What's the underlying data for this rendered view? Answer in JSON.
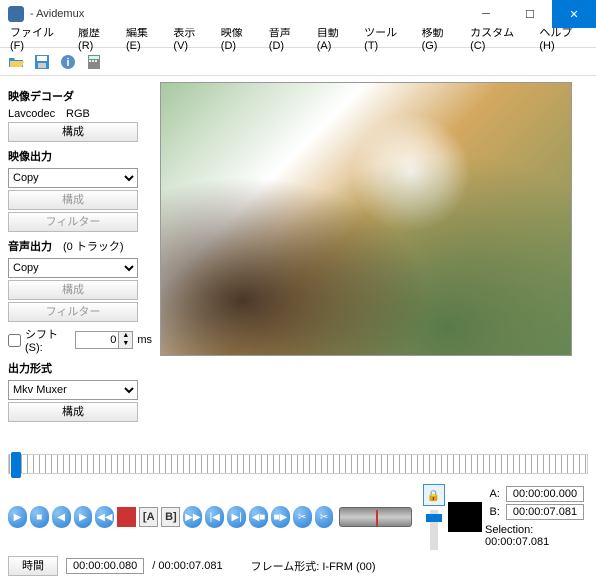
{
  "title": "- Avidemux",
  "menu": [
    "ファイル(F)",
    "履歴(R)",
    "編集(E)",
    "表示(V)",
    "映像(D)",
    "音声(D)",
    "自動(A)",
    "ツール(T)",
    "移動(G)",
    "カスタム(C)",
    "ヘルプ(H)"
  ],
  "sidebar": {
    "decoder_h": "映像デコーダ",
    "lavcodec": "Lavcodec",
    "rgb": "RGB",
    "configure": "構成",
    "video_out_h": "映像出力",
    "copy": "Copy",
    "filter": "フィルター",
    "audio_out_h": "音声出力",
    "audio_tracks": "(0 トラック)",
    "shift_label": "シフト(S):",
    "shift_val": "0",
    "ms": "ms",
    "format_h": "出力形式",
    "mkv": "Mkv Muxer"
  },
  "time": {
    "btn": "時間",
    "cur": "00:00:00.080",
    "dur": "/ 00:00:07.081",
    "frame": "フレーム形式: I-FRM (00)"
  },
  "ab": {
    "a_label": "A:",
    "a_val": "00:00:00.000",
    "b_label": "B:",
    "b_val": "00:00:07.081",
    "sel_label": "Selection:",
    "sel_val": "00:00:07.081"
  }
}
